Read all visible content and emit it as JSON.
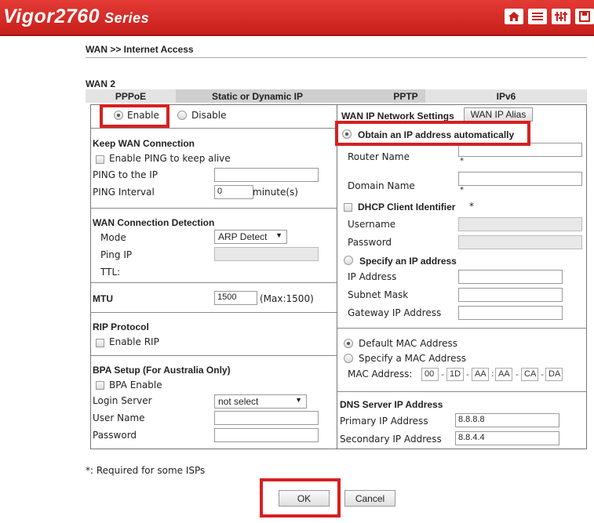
{
  "header": {
    "brand": "Vigor2760",
    "series": "Series",
    "icons": [
      "home-icon",
      "list-icon",
      "sliders-icon",
      "save-icon"
    ]
  },
  "breadcrumb": "WAN >> Internet Access",
  "wan_title": "WAN 2",
  "tabs": [
    "PPPoE",
    "Static or Dynamic IP",
    "PPTP",
    "IPv6"
  ],
  "left": {
    "enable": "Enable",
    "disable": "Disable",
    "keep_title": "Keep WAN Connection",
    "enable_ping": "Enable PING to keep alive",
    "ping_to_ip": "PING to the IP",
    "ping_to_ip_value": "",
    "ping_interval": "PING Interval",
    "ping_interval_value": "0",
    "minutes": "minute(s)",
    "detect_title": "WAN Connection Detection",
    "mode": "Mode",
    "mode_value": "ARP Detect",
    "ping_ip": "Ping IP",
    "ping_ip_value": "",
    "ttl": "TTL:",
    "mtu": "MTU",
    "mtu_value": "1500",
    "mtu_max": "(Max:1500)",
    "rip_title": "RIP Protocol",
    "enable_rip": "Enable RIP",
    "bpa_title": "BPA Setup (For Australia Only)",
    "bpa_enable": "BPA Enable",
    "login_server": "Login Server",
    "login_server_value": "not select",
    "user_name": "User Name",
    "user_name_value": "",
    "password": "Password",
    "password_value": ""
  },
  "right": {
    "net_title": "WAN IP Network Settings",
    "alias_btn": "WAN IP Alias",
    "obtain": "Obtain an IP address automatically",
    "router_name": "Router Name",
    "router_name_value": "",
    "domain_name": "Domain Name",
    "domain_name_value": "",
    "asterisk": "*",
    "dhcp_client": "DHCP Client Identifier",
    "dhcp_star": "*",
    "username": "Username",
    "password": "Password",
    "specify": "Specify an IP address",
    "ip_address": "IP Address",
    "subnet": "Subnet Mask",
    "gateway": "Gateway IP Address",
    "default_mac": "Default MAC Address",
    "specify_mac": "Specify a MAC Address",
    "mac_label": "MAC Address:",
    "mac": [
      "00",
      "1D",
      "AA",
      "AA",
      "CA",
      "DA"
    ],
    "mac_sep": [
      "-",
      "-",
      ":",
      "-",
      "-"
    ],
    "dns_title": "DNS Server IP Address",
    "primary": "Primary IP Address",
    "primary_value": "8.8.8.8",
    "secondary": "Secondary IP Address",
    "secondary_value": "8.8.4.4"
  },
  "footer_note": "*: Required for some ISPs",
  "ok": "OK",
  "cancel": "Cancel"
}
